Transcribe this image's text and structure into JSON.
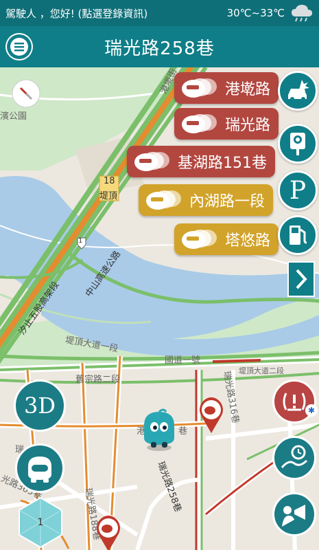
{
  "status_bar": {
    "greeting": "駕駛人 ，您好! (點選登錄資訊)",
    "temperature": "30℃~33℃",
    "weather_icon": "cloud-rain-icon"
  },
  "header": {
    "title": "瑞光路258巷",
    "menu_icon": "menu-icon"
  },
  "traffic_alerts": [
    {
      "road": "港墘路",
      "level": "heavy",
      "color": "#b24740"
    },
    {
      "road": "瑞光路",
      "level": "heavy",
      "color": "#b24740"
    },
    {
      "road": "基湖路151巷",
      "level": "heavy",
      "color": "#b24740"
    },
    {
      "road": "內湖路一段",
      "level": "slow",
      "color": "#d2a32a"
    },
    {
      "road": "塔悠路",
      "level": "slow",
      "color": "#d2a32a"
    }
  ],
  "side_buttons": {
    "accident": "car-crash-icon",
    "camera": "speed-camera-icon",
    "parking": "P",
    "fuel": "fuel-pump-icon",
    "expand": "chevron-right-icon"
  },
  "map": {
    "labels": {
      "park": "濱公園",
      "causeway": "堤頂",
      "exit_number": "18",
      "highway": "中山高速公路",
      "elevated": "汐止五股高架段",
      "dadao": "堤頂大道一段",
      "national1": "國道一號",
      "jiuzong": "舊宗路二段",
      "dadao2": "堤頂大道二段",
      "ruiguang258": "瑞光路258巷",
      "ruiguang316": "瑞光路316巷",
      "ruiguang188": "瑞光路188巷",
      "lane_tail": "巷",
      "partial_365": "光路365巷",
      "partial_lu": "瑞",
      "partial_top": "港墘街",
      "rd_shield": "1",
      "side_partial": "港"
    }
  },
  "buttons": {
    "three_d": "3D",
    "level": "1"
  },
  "colors": {
    "header": "#0f7e88",
    "statusbar": "#0e6f78",
    "heavy": "#b24740",
    "slow": "#d2a32a",
    "water": "#a9cbe8",
    "park": "#c7e6c0"
  }
}
